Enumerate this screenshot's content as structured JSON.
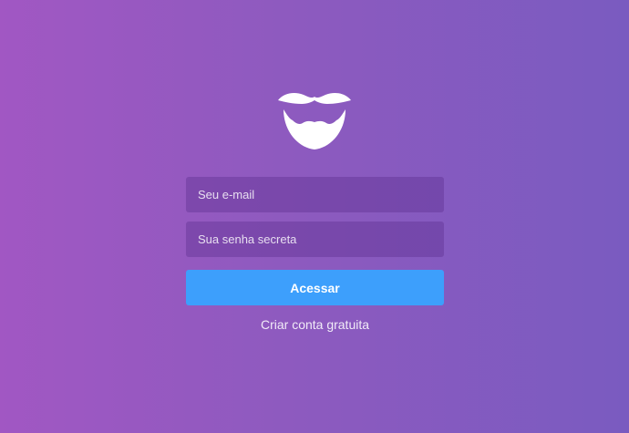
{
  "logo": {
    "icon": "mustache-beard-icon",
    "color": "#ffffff"
  },
  "form": {
    "email_placeholder": "Seu e-mail",
    "password_placeholder": "Sua senha secreta",
    "submit_label": "Acessar",
    "create_account_label": "Criar conta gratuita"
  },
  "colors": {
    "background_start": "#a157c3",
    "background_end": "#7a5bc0",
    "button": "#3d9ffc"
  }
}
